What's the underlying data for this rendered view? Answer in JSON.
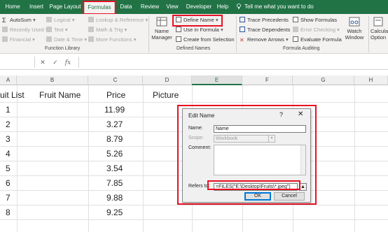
{
  "tabs": [
    "Home",
    "Insert",
    "Page Layout",
    "Formulas",
    "Data",
    "Review",
    "View",
    "Developer",
    "Help",
    "Search"
  ],
  "active_tab": "Formulas",
  "tell_me": "Tell me what you want to do",
  "ribbon": {
    "function_library": {
      "autosum": "AutoSum",
      "recently_used": "Recently Used",
      "financial": "Financial",
      "logical": "Logical",
      "text": "Text",
      "date_time": "Date & Time",
      "lookup": "Lookup & Reference",
      "math": "Math & Trig",
      "more": "More Functions",
      "group_label": "Function Library"
    },
    "defined_names": {
      "name_manager_line1": "Name",
      "name_manager_line2": "Manager",
      "define_name": "Define Name",
      "use_in_formula": "Use in Formula",
      "create_from_selection": "Create from Selection",
      "group_label": "Defined Names"
    },
    "formula_auditing": {
      "trace_precedents": "Trace Precedents",
      "trace_dependents": "Trace Dependents",
      "remove_arrows": "Remove Arrows",
      "show_formulas": "Show Formulas",
      "error_checking": "Error Checking",
      "evaluate_formula": "Evaluate Formula",
      "watch_window_line1": "Watch",
      "watch_window_line2": "Window",
      "group_label": "Formula Auditing"
    },
    "calculation": {
      "line1": "Calcula",
      "line2": "Option"
    }
  },
  "formula_bar": {
    "cancel": "✕",
    "enter": "✓",
    "fx": "fx"
  },
  "columns": [
    "A",
    "B",
    "C",
    "D",
    "E",
    "F",
    "G",
    "H"
  ],
  "selected_column": "E",
  "headers": {
    "fruit_list": "uit List",
    "fruit_name": "Fruit Name",
    "price": "Price",
    "picture": "Picture"
  },
  "rows": [
    {
      "num": "1",
      "price": "11.99"
    },
    {
      "num": "2",
      "price": "3.27"
    },
    {
      "num": "3",
      "price": "8.79"
    },
    {
      "num": "4",
      "price": "5.26"
    },
    {
      "num": "5",
      "price": "3.54"
    },
    {
      "num": "6",
      "price": "7.85"
    },
    {
      "num": "7",
      "price": "9.88"
    },
    {
      "num": "8",
      "price": "9.25"
    }
  ],
  "dialog": {
    "title": "Edit Name",
    "help": "?",
    "close": "✕",
    "name_label": "Name:",
    "name_value": "Name",
    "scope_label": "Scope:",
    "scope_value": "Workbook",
    "comment_label": "Comment:",
    "refers_to_label": "Refers to:",
    "refers_to_value": "=FILES(\"E:\\Desktop\\Fruits\\*.jpeg\")",
    "ok": "OK",
    "cancel": "Cancel"
  },
  "colors": {
    "excel_green": "#217346",
    "highlight_red": "#e81123"
  }
}
